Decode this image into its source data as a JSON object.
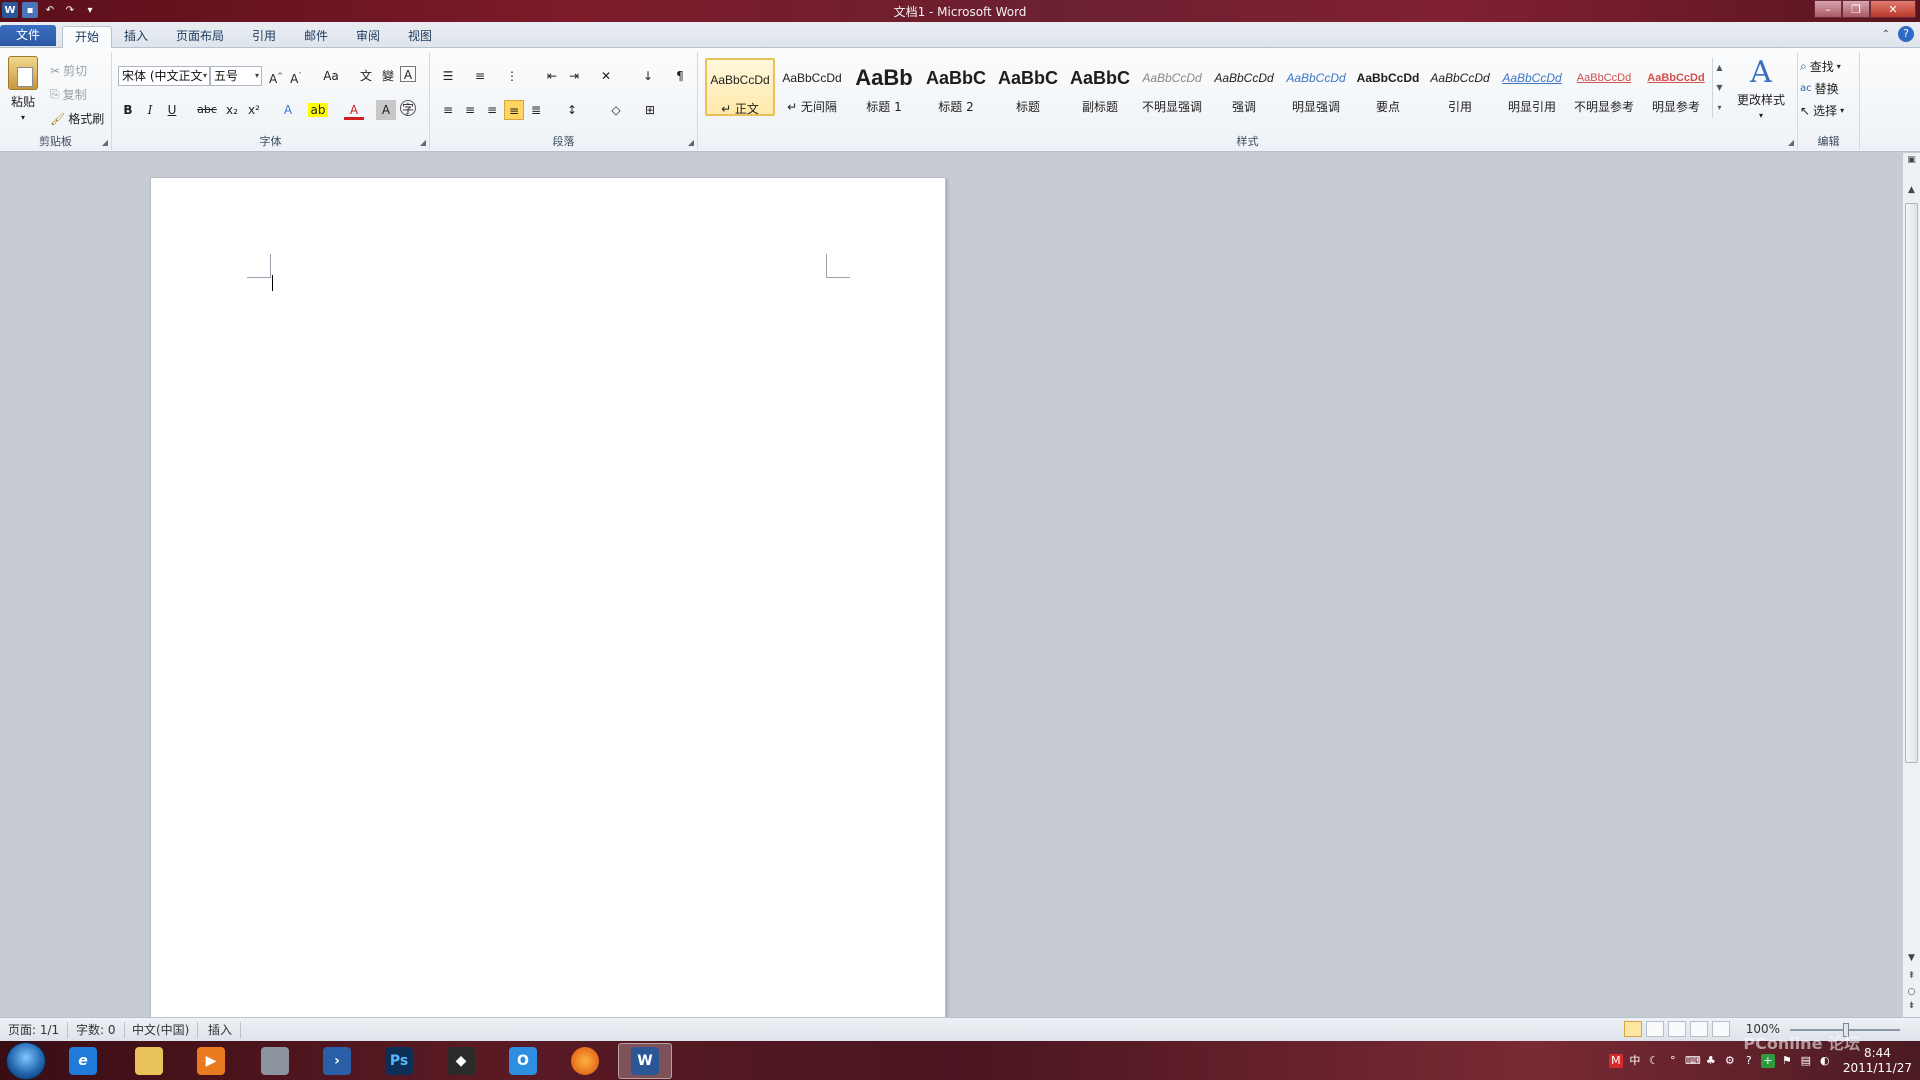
{
  "window": {
    "title": "文档1 - Microsoft Word"
  },
  "qat": {
    "app_icon": "W",
    "save_icon": "save-icon",
    "undo_icon": "undo-icon",
    "redo_icon": "redo-icon"
  },
  "tabs": [
    {
      "label": "文件"
    },
    {
      "label": "开始"
    },
    {
      "label": "插入"
    },
    {
      "label": "页面布局"
    },
    {
      "label": "引用"
    },
    {
      "label": "邮件"
    },
    {
      "label": "审阅"
    },
    {
      "label": "视图"
    }
  ],
  "clipboard": {
    "paste": "粘贴",
    "cut": "剪切",
    "copy": "复制",
    "format_painter": "格式刷",
    "group": "剪贴板"
  },
  "font": {
    "name": "宋体 (中文正文",
    "size": "五号",
    "group": "字体",
    "change_case": "Aa",
    "bold": "B",
    "italic": "I",
    "underline": "U",
    "strike": "abc",
    "subscript": "x₂",
    "superscript": "x²"
  },
  "paragraph": {
    "group": "段落"
  },
  "styles": {
    "group": "样式",
    "items": [
      {
        "sample": "AaBbCcDd",
        "name": "↵ 正文"
      },
      {
        "sample": "AaBbCcDd",
        "name": "↵ 无间隔"
      },
      {
        "sample": "AaBb",
        "name": "标题 1"
      },
      {
        "sample": "AaBbC",
        "name": "标题 2"
      },
      {
        "sample": "AaBbC",
        "name": "标题"
      },
      {
        "sample": "AaBbC",
        "name": "副标题"
      },
      {
        "sample": "AaBbCcDd",
        "name": "不明显强调"
      },
      {
        "sample": "AaBbCcDd",
        "name": "强调"
      },
      {
        "sample": "AaBbCcDd",
        "name": "明显强调"
      },
      {
        "sample": "AaBbCcDd",
        "name": "要点"
      },
      {
        "sample": "AaBbCcDd",
        "name": "引用"
      },
      {
        "sample": "AaBbCcDd",
        "name": "明显引用"
      },
      {
        "sample": "AaBbCcDd",
        "name": "不明显参考"
      },
      {
        "sample": "AaBbCcDd",
        "name": "明显参考"
      }
    ],
    "change_styles": "更改样式"
  },
  "editing": {
    "group": "编辑",
    "find": "查找",
    "replace": "替换",
    "select": "选择"
  },
  "statusbar": {
    "page": "页面: 1/1",
    "words": "字数: 0",
    "language": "中文(中国)",
    "mode": "插入",
    "zoom": "100%",
    "zoom_level": 1.0
  },
  "taskbar": {
    "apps": [
      "start-orb",
      "ie",
      "explorer",
      "media-player",
      "scanner",
      "powershell",
      "photoshop",
      "foxmail",
      "outlook",
      "firefox",
      "word"
    ],
    "clock_time": "8:44",
    "clock_date": "2011/11/27",
    "ime": "中"
  },
  "watermark": "PConline 论坛",
  "colors": {
    "accent": "#2b5797",
    "file_tab": "#2a58a6",
    "selected_style": "#ffe8a8",
    "title_bar": "#7c1a2a"
  }
}
